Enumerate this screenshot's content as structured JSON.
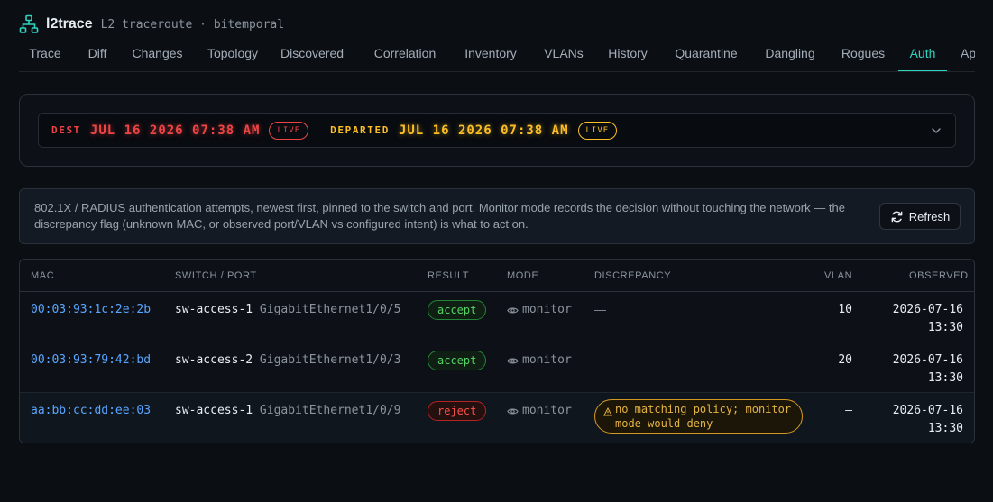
{
  "app": {
    "title": "l2trace",
    "subtitle": "L2 traceroute · bitemporal"
  },
  "tabs": [
    {
      "label": "Trace"
    },
    {
      "label": "Diff"
    },
    {
      "label": "Changes"
    },
    {
      "label": "Topology"
    },
    {
      "label": "Discovered"
    },
    {
      "label": "Correlation"
    },
    {
      "label": "Inventory"
    },
    {
      "label": "VLANs"
    },
    {
      "label": "History"
    },
    {
      "label": "Quarantine"
    },
    {
      "label": "Dangling"
    },
    {
      "label": "Rogues"
    },
    {
      "label": "Auth",
      "active": true
    },
    {
      "label": "Ap"
    }
  ],
  "clock": {
    "dest_label": "DEST",
    "dest_time": "JUL 16 2026 07:38 AM",
    "dest_live": "LIVE",
    "departed_label": "DEPARTED",
    "departed_time": "JUL 16 2026 07:38 AM",
    "departed_live": "LIVE"
  },
  "info": {
    "text": "802.1X / RADIUS authentication attempts, newest first, pinned to the switch and port. Monitor mode records the decision without touching the network — the discrepancy flag (unknown MAC, or observed port/VLAN vs configured intent) is what to act on.",
    "refresh_label": "Refresh"
  },
  "table": {
    "headers": {
      "mac": "MAC",
      "switch_port": "SWITCH / PORT",
      "result": "RESULT",
      "mode": "MODE",
      "discrepancy": "DISCREPANCY",
      "vlan": "VLAN",
      "observed": "OBSERVED"
    },
    "rows": [
      {
        "mac": "00:03:93:1c:2e:2b",
        "switch": "sw-access-1",
        "port": "GigabitEthernet1/0/5",
        "result": "accept",
        "mode": "monitor",
        "discrepancy": "—",
        "vlan": "10",
        "observed_date": "2026-07-16",
        "observed_time": "13:30"
      },
      {
        "mac": "00:03:93:79:42:bd",
        "switch": "sw-access-2",
        "port": "GigabitEthernet1/0/3",
        "result": "accept",
        "mode": "monitor",
        "discrepancy": "—",
        "vlan": "20",
        "observed_date": "2026-07-16",
        "observed_time": "13:30"
      },
      {
        "mac": "aa:bb:cc:dd:ee:03",
        "switch": "sw-access-1",
        "port": "GigabitEthernet1/0/9",
        "result": "reject",
        "mode": "monitor",
        "discrepancy": "no matching policy; monitor mode would deny",
        "vlan": "—",
        "observed_date": "2026-07-16",
        "observed_time": "13:30"
      }
    ]
  },
  "colors": {
    "accent": "#2dd4bf",
    "dest": "#ef4444",
    "departed": "#fbbf24",
    "accept": "#56d364",
    "reject": "#f85149",
    "warning": "#e3b341",
    "mac_link": "#58a6ff"
  },
  "icons": {
    "logo": "network-tree-icon",
    "chevron": "chevron-down-icon",
    "refresh": "refresh-icon",
    "mode": "eye-icon",
    "warning": "warning-triangle-icon"
  }
}
